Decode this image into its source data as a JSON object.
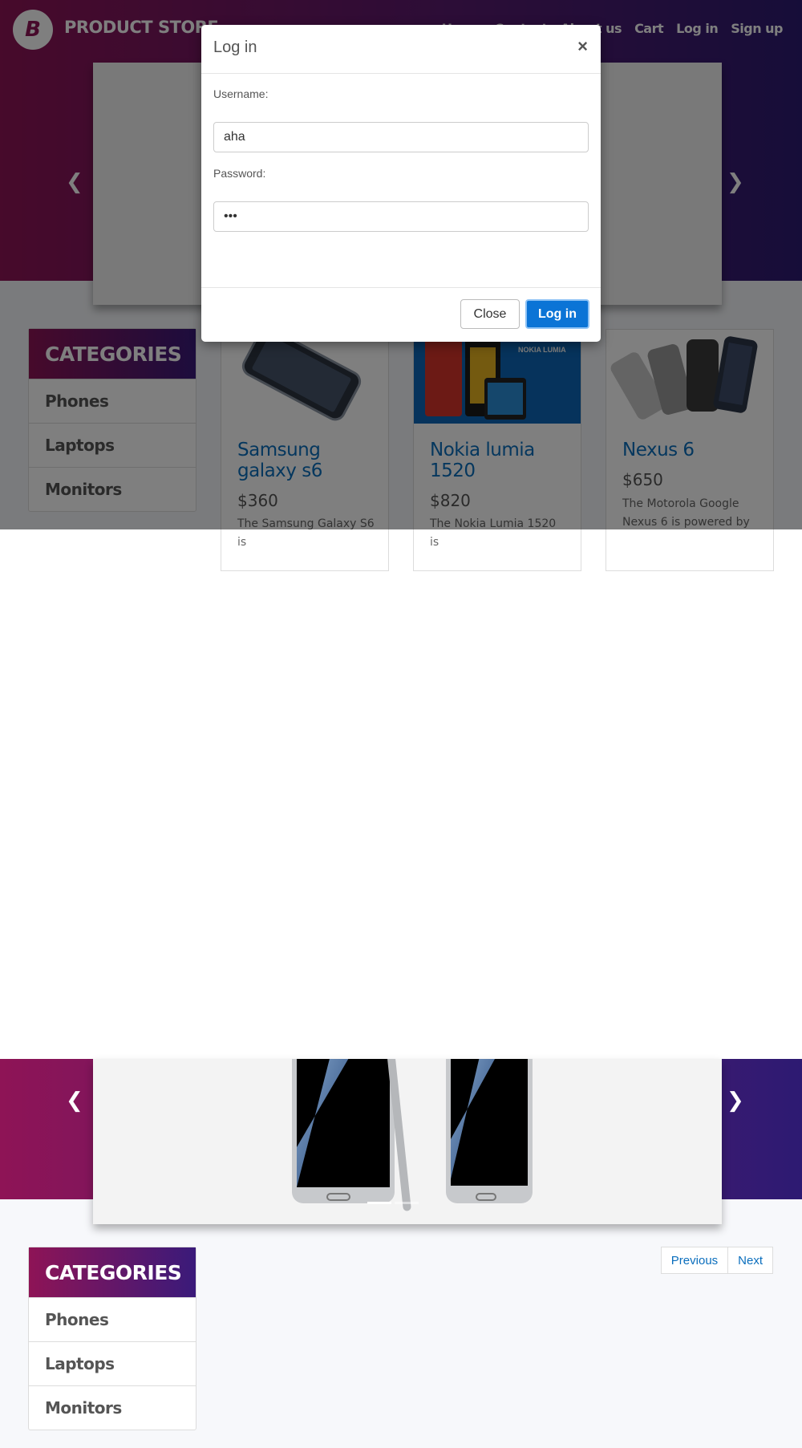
{
  "navbar": {
    "logo_letter": "B",
    "brand": "PRODUCT STORE",
    "links": [
      "Home",
      "Contact",
      "About us",
      "Cart",
      "Log in",
      "Sign up"
    ]
  },
  "carousel": {
    "prev_icon": "chevron-left-icon",
    "next_icon": "chevron-right-icon"
  },
  "categories": {
    "title": "CATEGORIES",
    "items": [
      "Phones",
      "Laptops",
      "Monitors"
    ]
  },
  "products": [
    {
      "name": "Samsung galaxy s6",
      "price": "$360",
      "desc": "The Samsung Galaxy S6 is"
    },
    {
      "name": "Nokia lumia 1520",
      "price": "$820",
      "desc": "The Nokia Lumia 1520 is",
      "image_text": "NOKIA LUMIA"
    },
    {
      "name": "Nexus 6",
      "price": "$650",
      "desc": "The Motorola Google Nexus 6 is powered by"
    }
  ],
  "modal": {
    "title": "Log in",
    "close_symbol": "×",
    "username_label": "Username:",
    "username_value": "aha",
    "password_label": "Password:",
    "password_value": "aha",
    "close_button": "Close",
    "login_button": "Log in"
  },
  "pagination": {
    "previous": "Previous",
    "next": "Next"
  },
  "colors": {
    "brand_gradient_start": "#8e1456",
    "brand_gradient_end": "#2d1a72",
    "link_blue": "#0a6ebd",
    "primary_button": "#0b74d6"
  }
}
